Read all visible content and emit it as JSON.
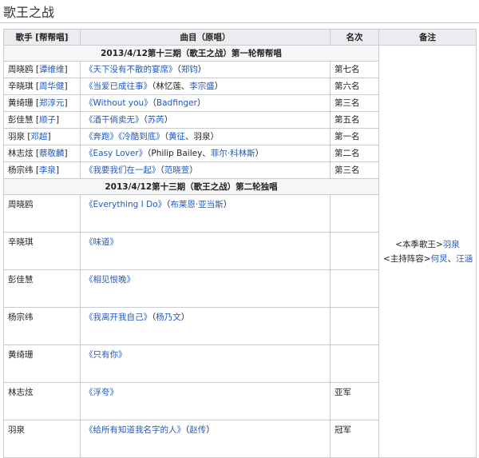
{
  "page_title": "歌王之战",
  "columns": {
    "singer": "歌手 [帮帮唱]",
    "song": "曲目（原唱）",
    "rank": "名次",
    "notes": "备注"
  },
  "round1": {
    "heading": "2013/4/12第十三期（歌王之战）第一轮帮帮唱",
    "rows": [
      {
        "singer": "周晓鸥",
        "helper": "谭维维",
        "song": "《天下没有不散的宴席》",
        "song2": "",
        "orig_open": "（",
        "orig_a": "郑钧",
        "orig_mid": "",
        "orig_b": "",
        "orig_close": "）",
        "rank": "第七名"
      },
      {
        "singer": "辛晓琪",
        "helper": "周华健",
        "song": "《当爱已成往事》",
        "song2": "",
        "orig_open": "（林忆莲、",
        "orig_a": "李宗盛",
        "orig_mid": "",
        "orig_b": "",
        "orig_close": "）",
        "rank": "第六名"
      },
      {
        "singer": "黄绮珊",
        "helper": "郑淳元",
        "song": "《Without you》",
        "song2": "",
        "orig_open": "（",
        "orig_a": "Badfinger",
        "orig_mid": "",
        "orig_b": "",
        "orig_close": "）",
        "rank": "第三名"
      },
      {
        "singer": "彭佳慧",
        "helper": "顺子",
        "song": "《酒干倘卖无》",
        "song2": "",
        "orig_open": "（",
        "orig_a": "苏芮",
        "orig_mid": "",
        "orig_b": "",
        "orig_close": "）",
        "rank": "第五名"
      },
      {
        "singer": "羽泉",
        "helper": "邓超",
        "song": "《奔跑》",
        "song2": "《冷酷到底》",
        "orig_open": "（",
        "orig_a": "黄征",
        "orig_mid": "、羽泉）",
        "orig_b": "",
        "orig_close": "",
        "rank": "第一名"
      },
      {
        "singer": "林志炫",
        "helper": "蔡敬麟",
        "song": "《Easy Lover》",
        "song2": "",
        "orig_open": "（Philip Bailey、",
        "orig_a": "菲尔·科林斯",
        "orig_mid": "",
        "orig_b": "",
        "orig_close": "）",
        "rank": "第二名"
      },
      {
        "singer": "杨宗纬",
        "helper": "李泉",
        "song": "《我要我们在一起》",
        "song2": "",
        "orig_open": "（",
        "orig_a": "范晓萱",
        "orig_mid": "",
        "orig_b": "",
        "orig_close": "）",
        "rank": "第三名"
      }
    ]
  },
  "round2": {
    "heading": "2013/4/12第十三期（歌王之战）第二轮独唱",
    "rows": [
      {
        "singer": "周晓鸥",
        "song": "《Everything I Do》",
        "orig_open": "（",
        "orig_a": "布莱恩·亚当斯",
        "orig_close": "）",
        "rank": ""
      },
      {
        "singer": "辛晓琪",
        "song": "《味道》",
        "orig_open": "",
        "orig_a": "",
        "orig_close": "",
        "rank": ""
      },
      {
        "singer": "彭佳慧",
        "song": "《相见恨晚》",
        "orig_open": "",
        "orig_a": "",
        "orig_close": "",
        "rank": ""
      },
      {
        "singer": "杨宗纬",
        "song": "《我离开我自己》",
        "orig_open": "（",
        "orig_a": "杨乃文",
        "orig_close": "）",
        "rank": ""
      },
      {
        "singer": "黄绮珊",
        "song": "《只有你》",
        "orig_open": "",
        "orig_a": "",
        "orig_close": "",
        "rank": ""
      },
      {
        "singer": "林志炫",
        "song": "《浮夸》",
        "orig_open": "",
        "orig_a": "",
        "orig_close": "",
        "rank": "亚军"
      },
      {
        "singer": "羽泉",
        "song": "《给所有知道我名字的人》",
        "orig_open": "（",
        "orig_a": "赵传",
        "orig_close": "）",
        "rank": "冠军"
      }
    ]
  },
  "notes": {
    "line1_prefix": "<本季歌王>",
    "line1_link": "羽泉",
    "line2_prefix": "<主持阵容>",
    "line2_link_a": "何炅",
    "line2_sep": "、",
    "line2_link_b": "汪涵"
  }
}
